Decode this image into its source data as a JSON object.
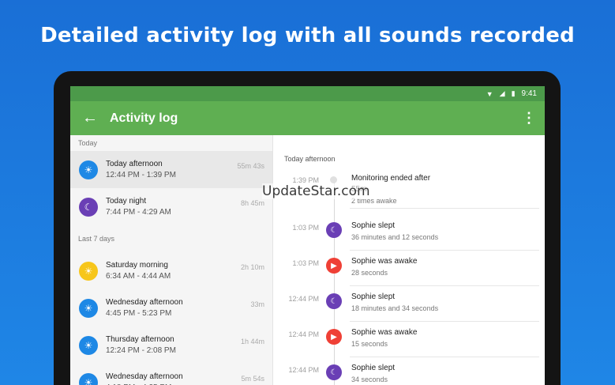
{
  "headline": "Detailed activity log with all sounds recorded",
  "status": {
    "time": "9:41"
  },
  "appbar": {
    "title": "Activity log"
  },
  "left": {
    "today_header": "Today",
    "today_items": [
      {
        "title": "Today afternoon",
        "range": "12:44 PM - 1:39 PM",
        "duration": "55m 43s",
        "icon": "sun-icon",
        "color": "blue"
      },
      {
        "title": "Today night",
        "range": "7:44 PM - 4:29 AM",
        "duration": "8h 45m",
        "icon": "moon-icon",
        "color": "purple"
      }
    ],
    "week_header": "Last 7 days",
    "week_items": [
      {
        "title": "Saturday morning",
        "range": "6:34 AM - 4:44 AM",
        "duration": "2h 10m",
        "icon": "sun-icon",
        "color": "yellow"
      },
      {
        "title": "Wednesday afternoon",
        "range": "4:45 PM - 5:23 PM",
        "duration": "33m",
        "icon": "sun-icon",
        "color": "blue"
      },
      {
        "title": "Thursday afternoon",
        "range": "12:24 PM - 2:08 PM",
        "duration": "1h 44m",
        "icon": "sun-icon",
        "color": "blue"
      },
      {
        "title": "Wednesday afternoon",
        "range": "4:18 PM - 4:25 PM",
        "duration": "5m 54s",
        "icon": "sun-icon",
        "color": "blue"
      }
    ]
  },
  "right": {
    "header": "Today afternoon",
    "events": [
      {
        "time": "1:39 PM",
        "title": "Monitoring ended after 55m",
        "sub": "2 times awake",
        "kind": "grey"
      },
      {
        "time": "1:03 PM",
        "title": "Sophie slept",
        "sub": "36 minutes and 12 seconds",
        "kind": "purple"
      },
      {
        "time": "1:03 PM",
        "title": "Sophie was awake",
        "sub": "28 seconds",
        "kind": "red"
      },
      {
        "time": "12:44 PM",
        "title": "Sophie slept",
        "sub": "18 minutes and 34 seconds",
        "kind": "purple"
      },
      {
        "time": "12:44 PM",
        "title": "Sophie was awake",
        "sub": "15 seconds",
        "kind": "red"
      },
      {
        "time": "12:44 PM",
        "title": "Sophie slept",
        "sub": "34 seconds",
        "kind": "purple"
      }
    ]
  },
  "watermark": "UpdateStar.com"
}
